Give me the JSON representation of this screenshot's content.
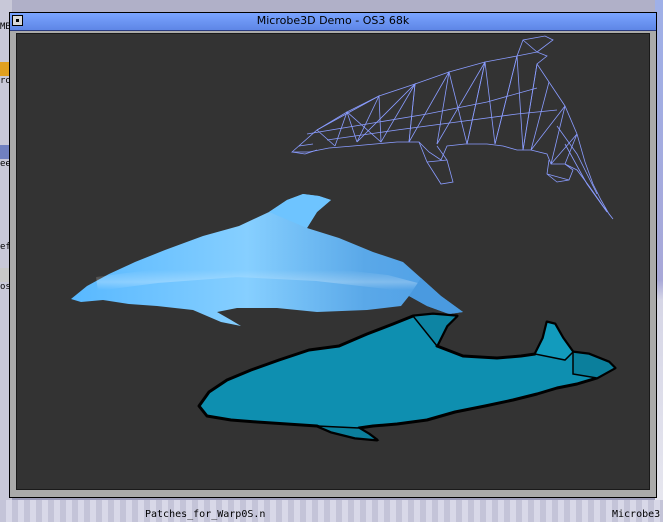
{
  "window": {
    "title": "Microbe3D Demo - OS3 68k"
  },
  "desktop": {
    "left_icon_labels": [
      "MB",
      "ro",
      "ee",
      "ef",
      "os"
    ],
    "bottom_labels": [
      "Patches_for_Warp0S.n",
      "Microbe3"
    ]
  },
  "scene": {
    "background_color": "#333333",
    "models": [
      {
        "name": "dolphin-wireframe",
        "style": "wireframe",
        "color": "#8a9cff"
      },
      {
        "name": "dolphin-smooth-shaded",
        "style": "gouraud",
        "color": "#5ab8ff"
      },
      {
        "name": "dolphin-flat-outlined",
        "style": "flat-outline",
        "color": "#0e8fb0"
      }
    ]
  }
}
